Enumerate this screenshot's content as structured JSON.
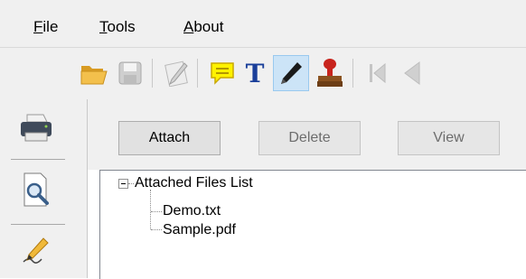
{
  "menu": {
    "file": {
      "accel": "F",
      "rest": "ile"
    },
    "tools": {
      "accel": "T",
      "rest": "ools"
    },
    "about": {
      "accel": "A",
      "rest": "bout"
    }
  },
  "toolbar": {
    "buttons": [
      {
        "icon": "open-folder-icon",
        "enabled": true
      },
      {
        "icon": "save-icon",
        "enabled": false
      },
      {
        "icon": "signature-pen-icon",
        "enabled": false
      },
      {
        "icon": "comment-note-icon",
        "enabled": true
      },
      {
        "icon": "text-tool-icon",
        "enabled": true
      },
      {
        "icon": "pencil-icon",
        "enabled": true,
        "active": true
      },
      {
        "icon": "stamp-icon",
        "enabled": true
      },
      {
        "icon": "first-page-icon",
        "enabled": false
      },
      {
        "icon": "previous-page-icon",
        "enabled": false
      }
    ],
    "text_tool_glyph": "T"
  },
  "leftbar": {
    "items": [
      {
        "icon": "printer-icon"
      },
      {
        "icon": "magnifier-icon"
      },
      {
        "icon": "signature-icon"
      }
    ]
  },
  "attachments": {
    "attach_label": "Attach",
    "delete_label": "Delete",
    "view_label": "View",
    "tree_root": "Attached Files List",
    "files": [
      "Demo.txt",
      "Sample.pdf"
    ]
  },
  "colors": {
    "folder": "#f0b93a",
    "note_yellow": "#fff200",
    "text_blue": "#1a3f9a",
    "stamp_red": "#c8241d",
    "stamp_handle": "#7a4a1c",
    "active_bg": "#cce4f7"
  }
}
